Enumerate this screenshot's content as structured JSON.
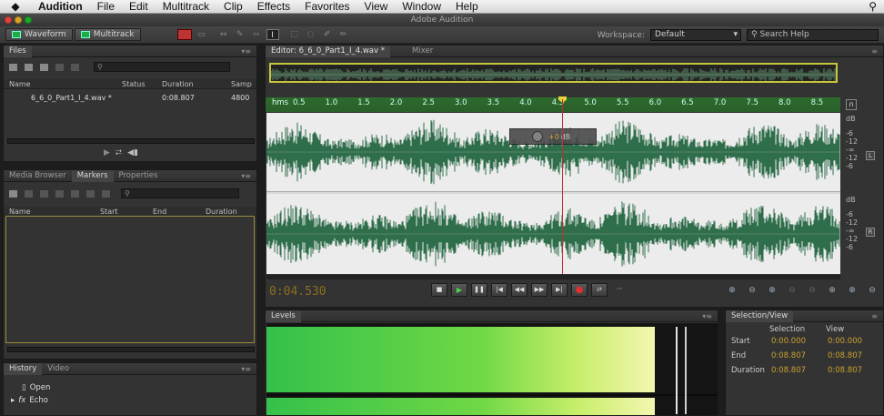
{
  "menubar": {
    "app_name": "Audition",
    "items": [
      "File",
      "Edit",
      "Multitrack",
      "Clip",
      "Effects",
      "Favorites",
      "View",
      "Window",
      "Help"
    ]
  },
  "window": {
    "title": "Adobe Audition"
  },
  "toolbar": {
    "waveform_label": "Waveform",
    "multitrack_label": "Multitrack",
    "workspace_label": "Workspace:",
    "workspace_value": "Default",
    "search_help_placeholder": "Search Help"
  },
  "files_panel": {
    "tab": "Files",
    "columns": {
      "name": "Name",
      "status": "Status",
      "duration": "Duration",
      "samp": "Samp"
    },
    "rows": [
      {
        "name": "6_6_0_Part1_I_4.wav *",
        "duration": "0:08.807",
        "samp": "4800"
      }
    ]
  },
  "markers_panel": {
    "tabs": [
      "Media Browser",
      "Markers",
      "Properties"
    ],
    "active_tab": "Markers",
    "columns": {
      "name": "Name",
      "start": "Start",
      "end": "End",
      "duration": "Duration"
    }
  },
  "history_panel": {
    "tabs": [
      "History",
      "Video"
    ],
    "items": [
      "Open",
      "Echo"
    ]
  },
  "editor": {
    "tab_label": "Editor: 6_6_0_Part1_I_4.wav *",
    "mixer_tab": "Mixer",
    "ruler_unit": "hms",
    "ruler_ticks": [
      "0.5",
      "1.0",
      "1.5",
      "2.0",
      "2.5",
      "3.0",
      "3.5",
      "4.0",
      "4.5",
      "5.0",
      "5.5",
      "6.0",
      "6.5",
      "7.0",
      "7.5",
      "8.0",
      "8.5"
    ],
    "hud_value": "+0",
    "hud_unit": "dB",
    "db_scale_top": [
      "dB",
      "-6",
      "-12",
      "-∞",
      "-12",
      "-6"
    ],
    "db_scale_bottom": [
      "dB",
      "-6",
      "-12",
      "-∞",
      "-12",
      "-6"
    ],
    "channel_left": "L",
    "channel_right": "R",
    "playhead_time": "0:04.530",
    "playhead_position": 0.515
  },
  "transport": {
    "buttons": [
      "stop-button",
      "play-button",
      "pause-button",
      "go-to-start-button",
      "rewind-button",
      "fast-forward-button",
      "go-to-end-button",
      "record-button",
      "loop-button",
      "skip-button"
    ]
  },
  "levels_panel": {
    "tab": "Levels",
    "level_left": 0.86,
    "level_right": 0.86
  },
  "selection_view": {
    "tab": "Selection/View",
    "col_selection": "Selection",
    "col_view": "View",
    "rows": [
      {
        "label": "Start",
        "selection": "0:00.000",
        "view": "0:00.000"
      },
      {
        "label": "End",
        "selection": "0:08.807",
        "view": "0:08.807"
      },
      {
        "label": "Duration",
        "selection": "0:08.807",
        "view": "0:08.807"
      }
    ]
  },
  "colors": {
    "waveform": "#2f6e4b",
    "playhead": "#c03030",
    "timecode": "#8c6e20",
    "ruler": "#2e6b2e"
  }
}
